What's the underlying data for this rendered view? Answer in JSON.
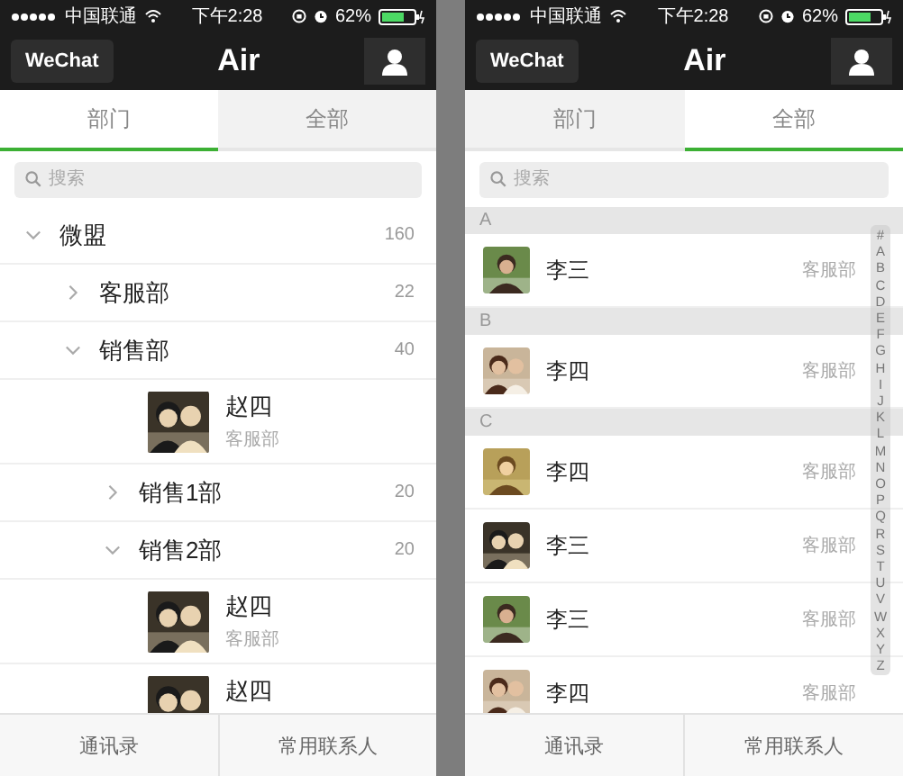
{
  "phones": [
    {
      "kind": "tree",
      "status_bar": {
        "carrier": "中国联通",
        "time": "下午2:28",
        "battery": "62%"
      },
      "nav": {
        "back": "WeChat",
        "title": "Air"
      },
      "tabs": [
        {
          "label": "部门",
          "selected": true
        },
        {
          "label": "全部",
          "selected": false
        }
      ],
      "search": {
        "placeholder": "搜索"
      },
      "tree": [
        {
          "kind": "group",
          "label": "微盟",
          "count": "160",
          "expanded": true,
          "children": [
            {
              "kind": "group",
              "label": "客服部",
              "count": "22",
              "expanded": false
            },
            {
              "kind": "group",
              "label": "销售部",
              "count": "40",
              "expanded": true,
              "children": [
                {
                  "kind": "person",
                  "name": "赵四",
                  "department": "客服部"
                },
                {
                  "kind": "group",
                  "label": "销售1部",
                  "count": "20",
                  "expanded": false
                },
                {
                  "kind": "group",
                  "label": "销售2部",
                  "count": "20",
                  "expanded": true,
                  "children": [
                    {
                      "kind": "person",
                      "name": "赵四",
                      "department": "客服部"
                    },
                    {
                      "kind": "person",
                      "name": "赵四"
                    }
                  ]
                }
              ]
            }
          ]
        }
      ],
      "bottom_tabs": [
        "通讯录",
        "常用联系人"
      ]
    },
    {
      "kind": "alphabet",
      "status_bar": {
        "carrier": "中国联通",
        "time": "下午2:28",
        "battery": "62%"
      },
      "nav": {
        "back": "WeChat",
        "title": "Air"
      },
      "tabs": [
        {
          "label": "部门",
          "selected": false
        },
        {
          "label": "全部",
          "selected": true
        }
      ],
      "search": {
        "placeholder": "搜索"
      },
      "sections": [
        {
          "letter": "A",
          "contacts": [
            {
              "name": "李三",
              "department": "客服部"
            }
          ]
        },
        {
          "letter": "B",
          "contacts": [
            {
              "name": "李四",
              "department": "客服部"
            }
          ]
        },
        {
          "letter": "C",
          "contacts": [
            {
              "name": "李四",
              "department": "客服部"
            },
            {
              "name": "李三",
              "department": "客服部"
            },
            {
              "name": "李三",
              "department": "客服部"
            },
            {
              "name": "李四",
              "department": "客服部"
            }
          ]
        }
      ],
      "index": [
        "#",
        "A",
        "B",
        "C",
        "D",
        "E",
        "F",
        "G",
        "H",
        "I",
        "J",
        "K",
        "L",
        "M",
        "N",
        "O",
        "P",
        "Q",
        "R",
        "S",
        "T",
        "U",
        "V",
        "W",
        "X",
        "Y",
        "Z"
      ],
      "bottom_tabs": [
        "通讯录",
        "常用联系人"
      ]
    }
  ]
}
